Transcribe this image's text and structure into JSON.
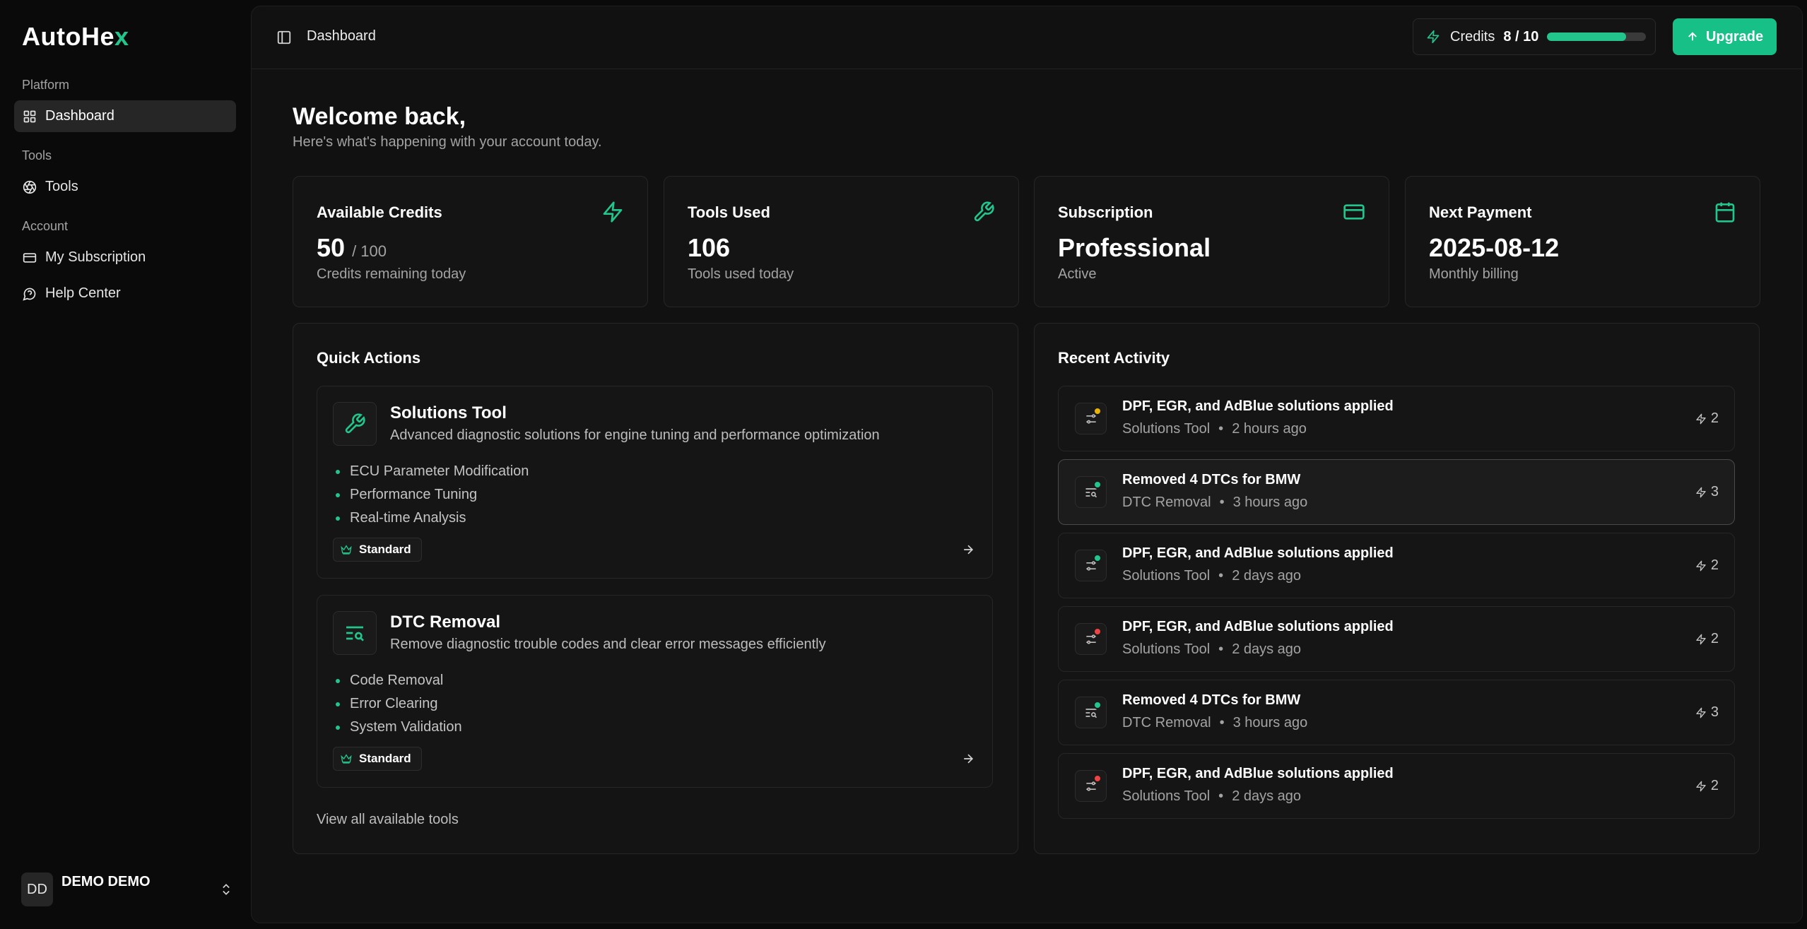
{
  "brand": {
    "name_prefix": "AutoHe",
    "name_x": "x"
  },
  "sidebar": {
    "groups": [
      {
        "label": "Platform",
        "items": [
          {
            "label": "Dashboard",
            "icon": "grid-icon",
            "active": true
          }
        ]
      },
      {
        "label": "Tools",
        "items": [
          {
            "label": "Tools",
            "icon": "aperture-icon"
          }
        ]
      },
      {
        "label": "Account",
        "items": [
          {
            "label": "My Subscription",
            "icon": "credit-card-icon"
          },
          {
            "label": "Help Center",
            "icon": "help-chat-icon"
          }
        ]
      }
    ],
    "user": {
      "initials": "DD",
      "name": "DEMO DEMO"
    }
  },
  "topbar": {
    "breadcrumb": "Dashboard",
    "credits_label": "Credits",
    "credits_value": "8 / 10",
    "credits_fraction": 0.8,
    "upgrade_label": "Upgrade"
  },
  "welcome": {
    "title": "Welcome back,",
    "subtitle": "Here's what's happening with your account today."
  },
  "stats": [
    {
      "title": "Available Credits",
      "value": "50",
      "value_of": "/ 100",
      "sub": "Credits remaining today",
      "icon": "zap-icon"
    },
    {
      "title": "Tools Used",
      "value": "106",
      "value_of": "",
      "sub": "Tools used today",
      "icon": "wrench-icon"
    },
    {
      "title": "Subscription",
      "value": "Professional",
      "value_of": "",
      "sub": "Active",
      "icon": "credit-card-icon"
    },
    {
      "title": "Next Payment",
      "value": "2025-08-12",
      "value_of": "",
      "sub": "Monthly billing",
      "icon": "calendar-icon"
    }
  ],
  "quick_actions": {
    "title": "Quick Actions",
    "tools": [
      {
        "name": "Solutions Tool",
        "desc": "Advanced diagnostic solutions for engine tuning and performance optimization",
        "features": [
          "ECU Parameter Modification",
          "Performance Tuning",
          "Real-time Analysis"
        ],
        "badge": "Standard",
        "icon": "wrench-icon"
      },
      {
        "name": "DTC Removal",
        "desc": "Remove diagnostic trouble codes and clear error messages efficiently",
        "features": [
          "Code Removal",
          "Error Clearing",
          "System Validation"
        ],
        "badge": "Standard",
        "icon": "list-search-icon"
      }
    ],
    "view_all": "View all available tools"
  },
  "recent_activity": {
    "title": "Recent Activity",
    "items": [
      {
        "title": "DPF, EGR, and AdBlue solutions applied",
        "tool": "Solutions Tool",
        "time": "2 hours ago",
        "cost": "2",
        "status_color": "#eab308",
        "icon": "sliders-icon"
      },
      {
        "title": "Removed 4 DTCs for BMW",
        "tool": "DTC Removal",
        "time": "3 hours ago",
        "cost": "3",
        "status_color": "#22c58b",
        "icon": "list-search-icon"
      },
      {
        "title": "DPF, EGR, and AdBlue solutions applied",
        "tool": "Solutions Tool",
        "time": "2 days ago",
        "cost": "2",
        "status_color": "#22c58b",
        "icon": "sliders-icon"
      },
      {
        "title": "DPF, EGR, and AdBlue solutions applied",
        "tool": "Solutions Tool",
        "time": "2 days ago",
        "cost": "2",
        "status_color": "#ef4444",
        "icon": "sliders-icon"
      },
      {
        "title": "Removed 4 DTCs for BMW",
        "tool": "DTC Removal",
        "time": "3 hours ago",
        "cost": "3",
        "status_color": "#22c58b",
        "icon": "list-search-icon"
      },
      {
        "title": "DPF, EGR, and AdBlue solutions applied",
        "tool": "Solutions Tool",
        "time": "2 days ago",
        "cost": "2",
        "status_color": "#ef4444",
        "icon": "sliders-icon"
      }
    ],
    "separator": "•"
  },
  "colors": {
    "accent": "#22c58b",
    "upgrade_bg": "#16c087"
  }
}
